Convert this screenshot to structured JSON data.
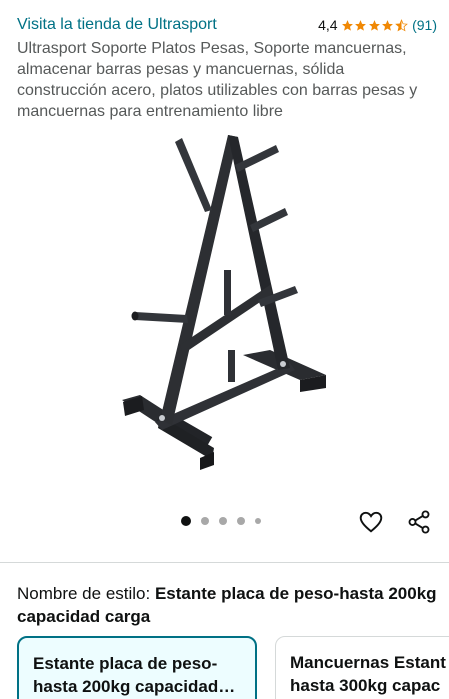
{
  "header": {
    "store_link": "Visita la tienda de Ultrasport",
    "rating_value": "4,4",
    "rating_stars": 4.5,
    "rating_count": "(91)"
  },
  "product": {
    "title": "Ultrasport Soporte Platos Pesas, Soporte mancuernas, almacenar barras pesas y mancuernas, sólida construcción acero, platos utilizables con barras pesas y mancuernas para entrenamiento libre",
    "image_icon": "weight-plate-rack-image",
    "carousel": {
      "total": 5,
      "active": 1
    }
  },
  "actions": {
    "wishlist_icon": "heart-icon",
    "share_icon": "share-icon"
  },
  "style_selector": {
    "label": "Nombre de estilo:",
    "value": "Estante placa de peso-hasta 200kg capacidad carga",
    "options": [
      {
        "label": "Estante placa de peso-hasta 200kg capacidad carga",
        "selected": true
      },
      {
        "label_line1": "Mancuernas Estant",
        "label_line2": "hasta 300kg capac",
        "selected": false
      }
    ]
  },
  "colors": {
    "link": "#007185",
    "star": "#f08804",
    "selected_border": "#007185",
    "selected_bg": "#edfdff"
  }
}
